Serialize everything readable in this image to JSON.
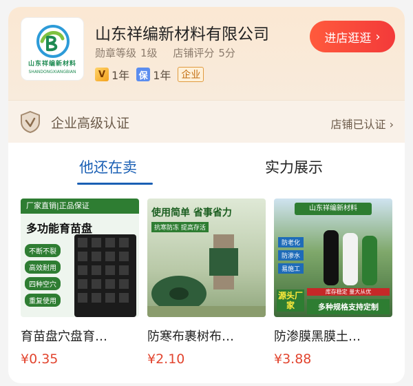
{
  "shop": {
    "name": "山东祥编新材料有限公司",
    "logo_text": "山东祥编新材料",
    "logo_sub": "SHANDONGXIANGBIAN",
    "medal_label": "勋章等级",
    "medal_value": "1级",
    "score_label": "店铺评分",
    "score_value": "5分",
    "badges": [
      {
        "icon": "V",
        "text": "1年"
      },
      {
        "icon": "保",
        "text": "1年"
      },
      {
        "text": "企业"
      }
    ],
    "enter_button": "进店逛逛"
  },
  "certification": {
    "label": "企业高级认证",
    "status": "店铺已认证"
  },
  "tabs": [
    {
      "label": "他还在卖",
      "active": true
    },
    {
      "label": "实力展示",
      "active": false
    }
  ],
  "products": [
    {
      "name": "育苗盘穴盘育…",
      "price": "¥0.35",
      "img_banner": "厂家直销|正品保证",
      "img_title": "多功能育苗盘",
      "img_tags": [
        "不断不裂",
        "高效耐用",
        "四种空穴",
        "重复使用"
      ]
    },
    {
      "name": "防寒布裹树布…",
      "price": "¥2.10",
      "img_title": "使用简单 省事省力",
      "img_sub": "抗寒防冻 提高存活"
    },
    {
      "name": "防渗膜黑膜土…",
      "price": "¥3.88",
      "img_banner": "山东祥编新材料",
      "img_tags": [
        "防老化",
        "防渗水",
        "易施工"
      ],
      "img_corner": "源头厂家",
      "img_foot_small": "库存稳定 量大从优",
      "img_foot_big": "多种规格支持定制"
    }
  ],
  "colors": {
    "accent_blue": "#1a5fb4",
    "price_red": "#e2452f",
    "enter_button": "#f33a3a"
  }
}
